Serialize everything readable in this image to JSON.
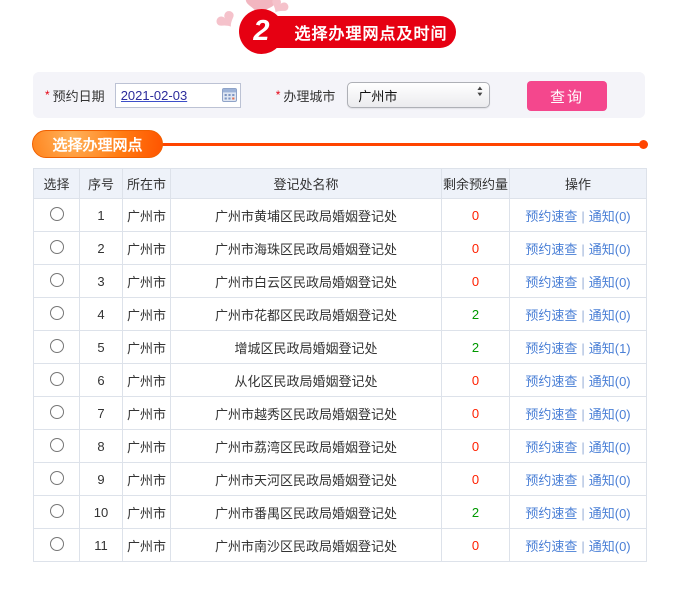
{
  "header": {
    "step_number": "2",
    "title": "选择办理网点及时间"
  },
  "form": {
    "required_marker": "*",
    "date_label": "预约日期",
    "date_value": "2021-02-03",
    "city_label": "办理城市",
    "city_value": "广州市",
    "query_button": "查询"
  },
  "section": {
    "title": "选择办理网点"
  },
  "table": {
    "headers": [
      "选择",
      "序号",
      "所在市",
      "登记处名称",
      "剩余预约量",
      "操作"
    ],
    "action_links": {
      "check": "预约速查",
      "separator": "|"
    },
    "rows": [
      {
        "no": "1",
        "city": "广州市",
        "name": "广州市黄埔区民政局婚姻登记处",
        "remaining": "0",
        "remaining_color": "red",
        "notify": "通知(0)"
      },
      {
        "no": "2",
        "city": "广州市",
        "name": "广州市海珠区民政局婚姻登记处",
        "remaining": "0",
        "remaining_color": "red",
        "notify": "通知(0)"
      },
      {
        "no": "3",
        "city": "广州市",
        "name": "广州市白云区民政局婚姻登记处",
        "remaining": "0",
        "remaining_color": "red",
        "notify": "通知(0)"
      },
      {
        "no": "4",
        "city": "广州市",
        "name": "广州市花都区民政局婚姻登记处",
        "remaining": "2",
        "remaining_color": "green",
        "notify": "通知(0)"
      },
      {
        "no": "5",
        "city": "广州市",
        "name": "增城区民政局婚姻登记处",
        "remaining": "2",
        "remaining_color": "green",
        "notify": "通知(1)"
      },
      {
        "no": "6",
        "city": "广州市",
        "name": "从化区民政局婚姻登记处",
        "remaining": "0",
        "remaining_color": "red",
        "notify": "通知(0)"
      },
      {
        "no": "7",
        "city": "广州市",
        "name": "广州市越秀区民政局婚姻登记处",
        "remaining": "0",
        "remaining_color": "red",
        "notify": "通知(0)"
      },
      {
        "no": "8",
        "city": "广州市",
        "name": "广州市荔湾区民政局婚姻登记处",
        "remaining": "0",
        "remaining_color": "red",
        "notify": "通知(0)"
      },
      {
        "no": "9",
        "city": "广州市",
        "name": "广州市天河区民政局婚姻登记处",
        "remaining": "0",
        "remaining_color": "red",
        "notify": "通知(0)"
      },
      {
        "no": "10",
        "city": "广州市",
        "name": "广州市番禺区民政局婚姻登记处",
        "remaining": "2",
        "remaining_color": "green",
        "notify": "通知(0)"
      },
      {
        "no": "11",
        "city": "广州市",
        "name": "广州市南沙区民政局婚姻登记处",
        "remaining": "0",
        "remaining_color": "red",
        "notify": "通知(0)"
      }
    ]
  },
  "colors": {
    "brand_red": "#e60012",
    "button_pink": "#f4478d",
    "section_orange": "#ff5400",
    "divider_orange": "#ff4400",
    "link_blue": "#4a7fd6",
    "remaining_red": "#ff2000",
    "remaining_green": "#009900",
    "form_background": "#f4f4f9",
    "table_header_background": "#eef2f9"
  }
}
